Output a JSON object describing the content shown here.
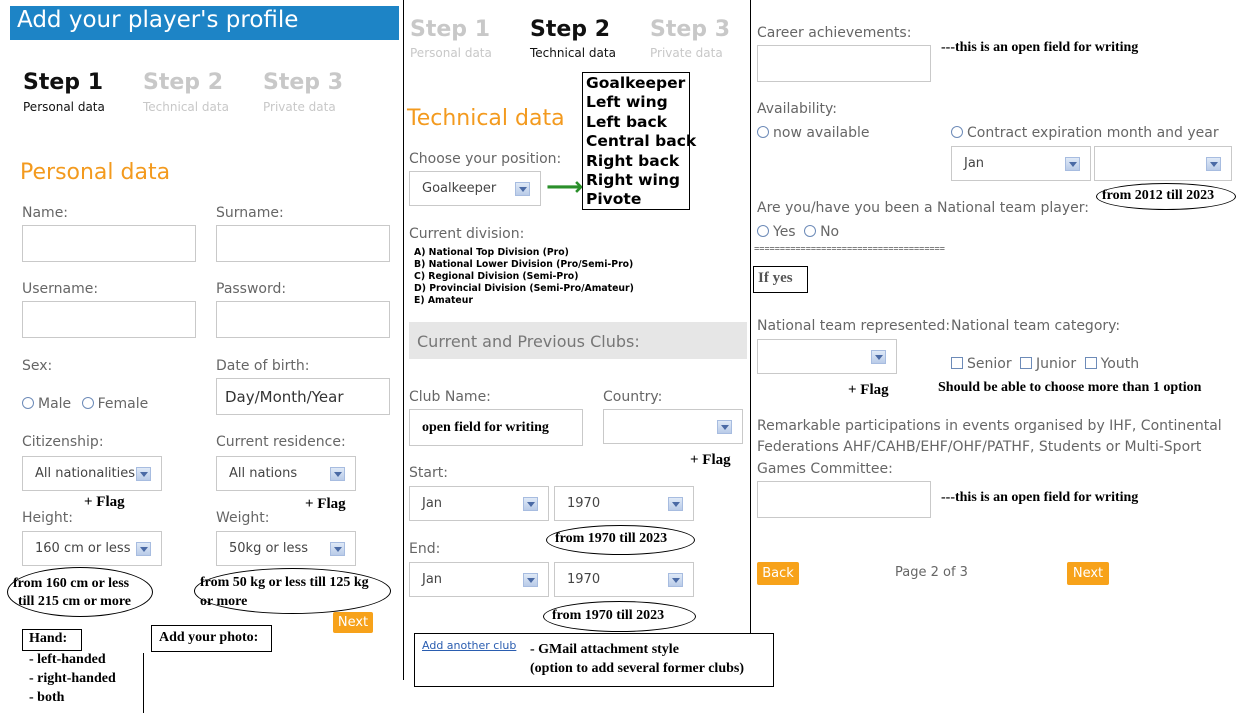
{
  "header": {
    "title": "Add your player's profile",
    "bg": "#1d84c6"
  },
  "steps": [
    {
      "num": "Step 1",
      "sub": "Personal data"
    },
    {
      "num": "Step 2",
      "sub": "Technical data"
    },
    {
      "num": "Step 3",
      "sub": "Private data"
    }
  ],
  "personal": {
    "heading": "Personal data",
    "name_label": "Name:",
    "surname_label": "Surname:",
    "username_label": "Username:",
    "password_label": "Password:",
    "sex_label": "Sex:",
    "male": "Male",
    "female": "Female",
    "dob_label": "Date of birth:",
    "dob_value": "Day/Month/Year",
    "citizenship_label": "Citizenship:",
    "citizenship_value": "All nationalities",
    "residence_label": "Current residence:",
    "residence_value": "All nations",
    "flag_note": "+ Flag",
    "height_label": "Height:",
    "height_value": "160 cm or less",
    "weight_label": "Weight:",
    "weight_value": "50kg or less",
    "height_note_1": "from 160 cm or less",
    "height_note_2": "till 215 cm or more",
    "weight_note_1": "from 50 kg or less till 125 kg",
    "weight_note_2": "or more",
    "next": "Next",
    "hand_label": "Hand:",
    "hand_options": [
      "- left-handed",
      "- right-handed",
      "- both"
    ],
    "photo_label": "Add your photo:"
  },
  "technical": {
    "heading": "Technical data",
    "position_label": "Choose your position:",
    "position_value": "Goalkeeper",
    "arrow": "⟶",
    "positions": [
      "Goalkeeper",
      "Left wing",
      "Left back",
      "Central back",
      "Right back",
      "Right wing",
      "Pivote"
    ],
    "division_label": "Current division:",
    "divisions": [
      "A) National Top Division (Pro)",
      "B) National Lower Division (Pro/Semi-Pro)",
      "C) Regional Division (Semi-Pro)",
      "D) Provincial Division (Semi-Pro/Amateur)",
      "E) Amateur"
    ],
    "clubs_heading": "Current and Previous Clubs:",
    "club_name_label": "Club Name:",
    "club_name_value": "open field for writing",
    "country_label": "Country:",
    "flag_note": "+ Flag",
    "start_label": "Start:",
    "start_month": "Jan",
    "start_year": "1970",
    "start_note": "from 1970 till 2023",
    "end_label": "End:",
    "end_month": "Jan",
    "end_year": "1970",
    "end_note": "from 1970 till 2023",
    "add_club": "Add another club",
    "add_club_note_1": "- GMail attachment style",
    "add_club_note_2": "(option to add several former clubs)"
  },
  "private": {
    "career_label": "Career achievements:",
    "open_note": "---this is an open field for writing",
    "availability_label": "Availability:",
    "now_available": "now available",
    "contract_label": "Contract expiration month and year",
    "contract_month": "Jan",
    "contract_note": "from 2012 till 2023",
    "national_q": "Are you/have you been a National team player:",
    "yes": "Yes",
    "no": "No",
    "separator": "=====================================",
    "if_yes": "If yes",
    "team_represented_label": "National team represented:",
    "team_category_label": "National team category:",
    "senior": "Senior",
    "junior": "Junior",
    "youth": "Youth",
    "flag_note": "+ Flag",
    "multi_note": "Should be able to choose more than 1 option",
    "remarkable_1": "Remarkable participations in events organised by IHF, Continental",
    "remarkable_2": "Federations AHF/CAHB/EHF/OHF/PATHF, Students or Multi-Sport",
    "remarkable_3": "Games Committee:",
    "back": "Back",
    "page": "Page 2 of 3",
    "next": "Next"
  },
  "colors": {
    "accent": "#f39a1e",
    "header": "#1d84c6",
    "link": "#2a5db0",
    "clubs_bg": "#e6e6e6"
  }
}
